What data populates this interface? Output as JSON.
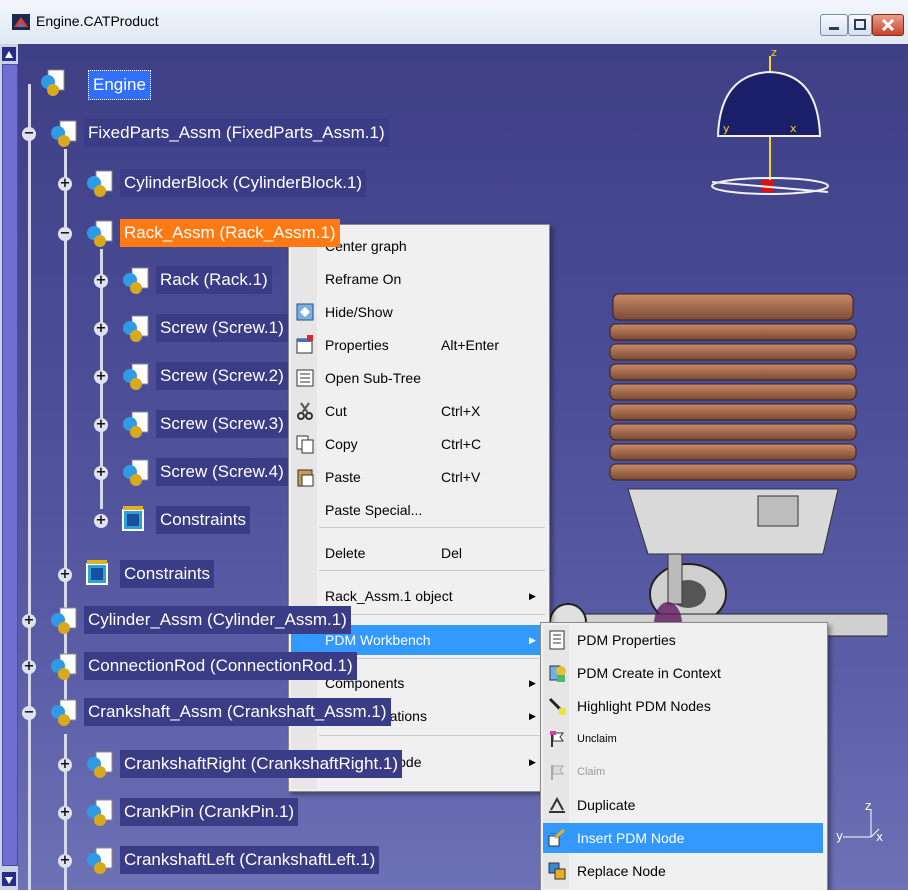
{
  "window": {
    "title": "Engine.CATProduct",
    "buttons": {
      "minimize": "minimize",
      "maximize": "maximize",
      "close": "close"
    }
  },
  "tree": {
    "root": "Engine",
    "nodes": [
      {
        "label": "FixedParts_Assm (FixedParts_Assm.1)",
        "expander": "−"
      },
      {
        "label": "CylinderBlock (CylinderBlock.1)",
        "expander": "+"
      },
      {
        "label": "Rack_Assm (Rack_Assm.1)",
        "expander": "−",
        "selected": true
      },
      {
        "label": "Rack (Rack.1)",
        "expander": "+"
      },
      {
        "label": "Screw (Screw.1)",
        "expander": "+"
      },
      {
        "label": "Screw (Screw.2)",
        "expander": "+"
      },
      {
        "label": "Screw (Screw.3)",
        "expander": "+"
      },
      {
        "label": "Screw (Screw.4)",
        "expander": "+"
      },
      {
        "label": "Constraints",
        "expander": "+"
      },
      {
        "label": "Constraints",
        "expander": "+"
      },
      {
        "label": "Cylinder_Assm (Cylinder_Assm.1)",
        "expander": "+"
      },
      {
        "label": "ConnectionRod (ConnectionRod.1)",
        "expander": "+"
      },
      {
        "label": "Crankshaft_Assm (Crankshaft_Assm.1)",
        "expander": "−"
      },
      {
        "label": "CrankshaftRight (CrankshaftRight.1)",
        "expander": "+"
      },
      {
        "label": "CrankPin (CrankPin.1)",
        "expander": "+"
      },
      {
        "label": "CrankshaftLeft (CrankshaftLeft.1)",
        "expander": "+"
      }
    ]
  },
  "context_menu": {
    "items": [
      {
        "label": "Center graph"
      },
      {
        "label": "Reframe On"
      },
      {
        "label": "Hide/Show",
        "icon": "hide-show-icon"
      },
      {
        "label": "Properties",
        "shortcut": "Alt+Enter",
        "icon": "properties-icon"
      },
      {
        "label": "Open Sub-Tree",
        "icon": "open-subtree-icon"
      },
      {
        "label": "Cut",
        "shortcut": "Ctrl+X",
        "icon": "scissors-icon"
      },
      {
        "label": "Copy",
        "shortcut": "Ctrl+C",
        "icon": "copy-icon"
      },
      {
        "label": "Paste",
        "shortcut": "Ctrl+V",
        "icon": "paste-icon"
      },
      {
        "label": "Paste Special..."
      },
      {
        "label": "Delete",
        "shortcut": "Del"
      },
      {
        "label": "Rack_Assm.1 object",
        "submenu": true
      },
      {
        "label": "PDM Workbench",
        "submenu": true,
        "highlighted": true
      },
      {
        "label": "Components",
        "submenu": true
      },
      {
        "label": "Representations",
        "submenu": true
      },
      {
        "label": "Selection Mode",
        "submenu": true
      }
    ]
  },
  "submenu": {
    "items": [
      {
        "label": "PDM Properties",
        "icon": "pdm-properties-icon"
      },
      {
        "label": "PDM Create in Context",
        "icon": "pdm-create-icon"
      },
      {
        "label": "Highlight PDM Nodes",
        "icon": "highlight-icon"
      },
      {
        "label": "Unclaim",
        "icon": "unclaim-icon"
      },
      {
        "label": "Claim",
        "icon": "claim-icon",
        "disabled": true
      },
      {
        "label": "Duplicate",
        "icon": "duplicate-icon"
      },
      {
        "label": "Insert PDM Node",
        "icon": "insert-node-icon",
        "highlighted": true
      },
      {
        "label": "Replace Node",
        "icon": "replace-node-icon"
      }
    ]
  },
  "compass": {
    "z": "z",
    "x": "x",
    "y": "y"
  },
  "axis_triad": {
    "z": "z",
    "x": "x",
    "y": "y"
  },
  "colors": {
    "background_top": "#3e3f85",
    "selection": "#ff7a12",
    "menu_highlight": "#3399ff",
    "head_fins": "#b5714f"
  }
}
